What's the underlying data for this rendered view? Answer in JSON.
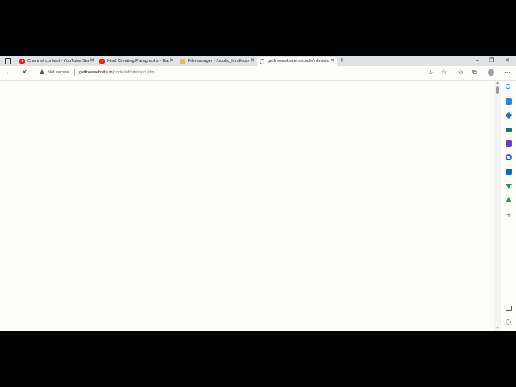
{
  "tabs": [
    {
      "title": "Channel content - YouTube Studio",
      "favicon": "youtube-icon",
      "active": false
    },
    {
      "title": "Html Creating Paragraphs - Basic",
      "favicon": "youtube-icon",
      "active": false
    },
    {
      "title": "Filemanager - /public_html/code",
      "favicon": "folder-icon",
      "active": false
    },
    {
      "title": "getfreewebsite.in/code/infiniteloop.php",
      "favicon": "loading-icon",
      "active": true
    }
  ],
  "new_tab_symbol": "+",
  "window_controls": {
    "minimize": "–",
    "restore": "❐",
    "close": "✕"
  },
  "address_bar": {
    "security_label": "Not secure",
    "url_host": "getfreewebsite.in",
    "url_path": "/code/infiniteloop.php"
  },
  "toolbar_icons": [
    "back-icon",
    "stop-icon",
    "read-aloud-icon",
    "add-favorite-icon",
    "favorites-icon",
    "collections-icon",
    "profile-icon",
    "more-icon"
  ],
  "sidebar_icons": [
    "search-icon",
    "bing-icon",
    "shopping-icon",
    "tools-icon",
    "games-icon",
    "microsoft365-icon",
    "outlook-icon",
    "drop-icon",
    "e-tree-icon",
    "add-icon",
    "hide-sidebar-icon",
    "settings-icon"
  ],
  "colors": {
    "tabstrip": "#dfe3e6",
    "page_background": "#fdfdfa",
    "youtube": "#e62117",
    "edge_blue": "#1a73e8"
  }
}
